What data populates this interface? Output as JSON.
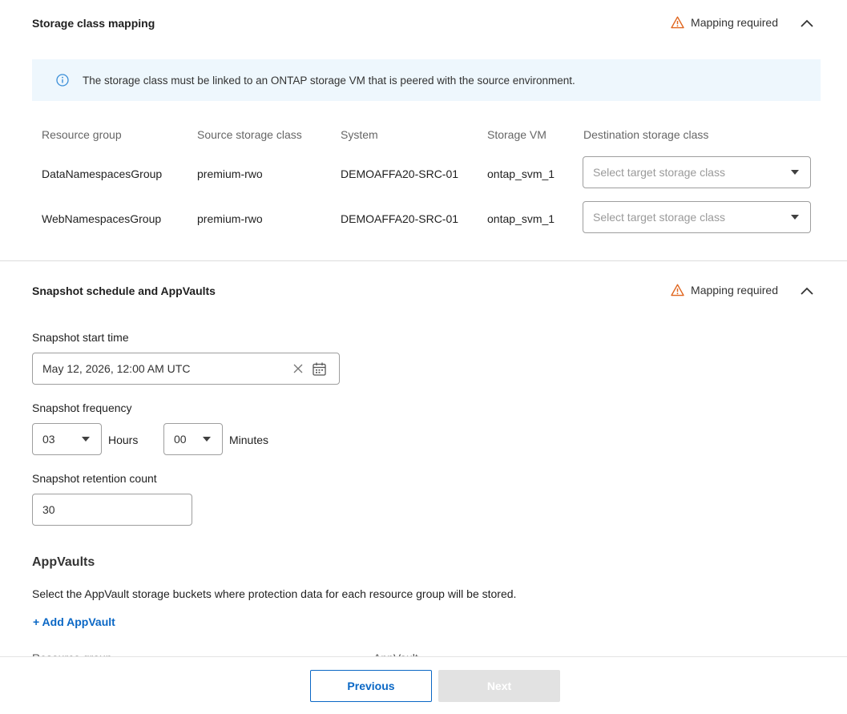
{
  "storage_mapping": {
    "title": "Storage class mapping",
    "status": "Mapping required",
    "info": "The storage class must be linked to an ONTAP storage VM that is peered with the source environment.",
    "columns": [
      "Resource group",
      "Source storage class",
      "System",
      "Storage VM",
      "Destination storage class"
    ],
    "rows": [
      {
        "resource_group": "DataNamespacesGroup",
        "source_class": "premium-rwo",
        "system": "DEMOAFFA20-SRC-01",
        "storage_vm": "ontap_svm_1",
        "destination_placeholder": "Select target storage class"
      },
      {
        "resource_group": "WebNamespacesGroup",
        "source_class": "premium-rwo",
        "system": "DEMOAFFA20-SRC-01",
        "storage_vm": "ontap_svm_1",
        "destination_placeholder": "Select target storage class"
      }
    ]
  },
  "snapshot": {
    "title": "Snapshot schedule and AppVaults",
    "status": "Mapping required",
    "start_time_label": "Snapshot start time",
    "start_time_value": "May 12, 2026, 12:00 AM UTC",
    "frequency_label": "Snapshot frequency",
    "hours_value": "03",
    "hours_unit": "Hours",
    "minutes_value": "00",
    "minutes_unit": "Minutes",
    "retention_label": "Snapshot retention count",
    "retention_value": "30"
  },
  "appvaults": {
    "title": "AppVaults",
    "description": "Select the AppVault storage buckets where protection data for each resource group will be stored.",
    "add_label": "+ Add AppVault",
    "col_left": "Resource group",
    "col_right": "AppVault"
  },
  "footer": {
    "previous": "Previous",
    "next": "Next"
  },
  "colors": {
    "accent": "#0a67c5",
    "warning": "#e0661f",
    "info": "#3b8fd8",
    "info_bg": "#eef7fd"
  }
}
